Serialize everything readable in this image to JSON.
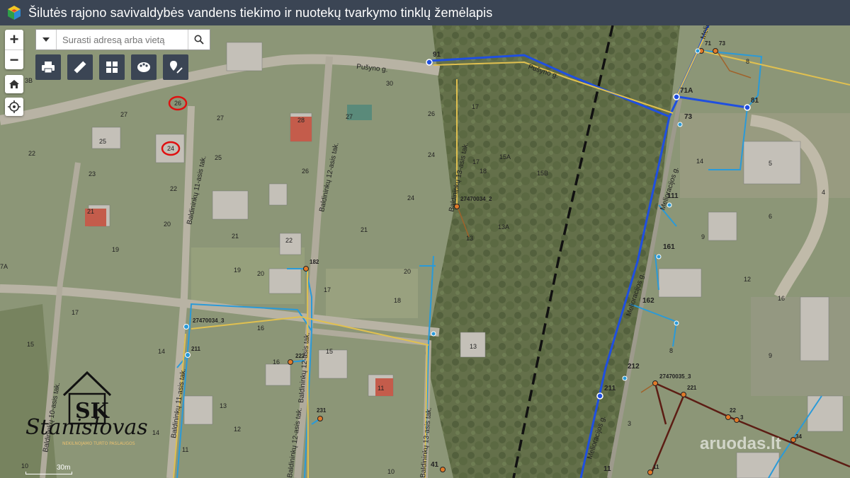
{
  "header": {
    "title": "Šilutės rajono savivaldybės vandens tiekimo ir nuotekų tvarkymo tinklų žemėlapis",
    "logo_icon": "cube-logo-icon"
  },
  "controls": {
    "zoom_in": "+",
    "zoom_out": "−",
    "home_icon": "home-icon",
    "locate_icon": "locate-icon"
  },
  "search": {
    "placeholder": "Surasti adresą arba vietą",
    "value": ""
  },
  "toolbar": [
    {
      "name": "print-icon"
    },
    {
      "name": "measure-ruler-icon"
    },
    {
      "name": "basemap-gallery-icon"
    },
    {
      "name": "layers-palette-icon"
    },
    {
      "name": "draw-marker-icon"
    }
  ],
  "map": {
    "streets": {
      "pusyno_1": "Pušyno g.",
      "pusyno_2": "Pušyno g.",
      "baldininku_10": "Baldininkų 10-asis tak.",
      "baldininku_11": "Baldininkų 11-asis tak.",
      "baldininku_11_b": "Baldininkų 11-asis tak.",
      "baldininku_12": "Baldininkų 12-asis tak.",
      "baldininku_12_b": "Baldininkų 12-asis tak.",
      "baldininku_12_c": "Baldininkų 12-asis tak.",
      "baldininku_13": "Baldininkų 13-asis tak.",
      "baldininku_13_b": "Baldininkų 13-asis tak.",
      "melioracijos_1": "Melioracijos g.",
      "melioracijos_2": "Melioracijos g.",
      "melioracijos_3": "Melioracijos g.",
      "melioracijos_4": "Melioracijos g."
    },
    "nodes": [
      "91",
      "71",
      "73",
      "71A",
      "81",
      "73",
      "111",
      "161",
      "162",
      "182",
      "27470034_3",
      "211",
      "222",
      "231",
      "27470034_2",
      "212",
      "27470035_3",
      "221",
      "211",
      "22",
      "3",
      "34",
      "41",
      "11",
      "11"
    ],
    "house_numbers": [
      "30",
      "27",
      "27",
      "28",
      "27",
      "26",
      "24",
      "25",
      "25",
      "22",
      "23",
      "22",
      "26",
      "21",
      "20",
      "21",
      "19",
      "19",
      "20",
      "22",
      "21",
      "20",
      "17",
      "18",
      "17",
      "16",
      "15",
      "16",
      "15",
      "14",
      "13",
      "12",
      "11",
      "10",
      "13",
      "14",
      "11",
      "10",
      "15",
      "16",
      "17",
      "18",
      "15",
      "15A",
      "15B",
      "24",
      "13A",
      "13",
      "14",
      "17",
      "17",
      "8",
      "8",
      "9",
      "8",
      "3",
      "4",
      "5",
      "6",
      "7",
      "10",
      "20",
      "17",
      "16",
      "12",
      "9",
      "8",
      "5",
      "11",
      "26",
      "24",
      "23",
      "22",
      "20",
      "3B",
      "7A"
    ],
    "marked_parcels": [
      "26",
      "24"
    ]
  },
  "scale": {
    "label": "30m"
  },
  "watermark": {
    "brand": "Stanislovas",
    "initials": "SK",
    "tagline": "NEKILNOJAMO TURTO PASLAUGOS"
  },
  "aruodas": "aruodas.lt",
  "colors": {
    "header_bg": "#3b4554",
    "water_main": "#1f4fe0",
    "water_pipe": "#2a9ad8",
    "sewer": "#e0c050",
    "sewer_brown": "#5c1d14",
    "node_orange": "#e07a2a",
    "marker_red": "#e01010"
  }
}
